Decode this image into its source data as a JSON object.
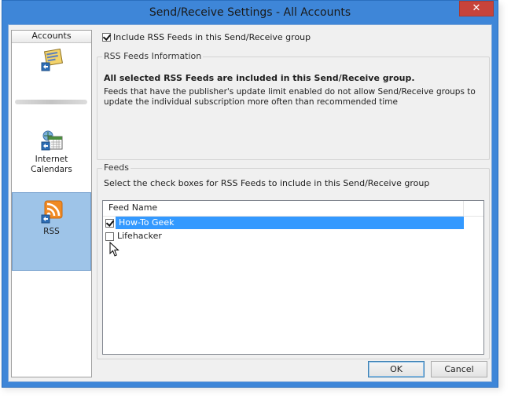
{
  "window": {
    "title": "Send/Receive Settings - All Accounts",
    "close_glyph": "✕"
  },
  "sidebar": {
    "header": "Accounts",
    "items": [
      {
        "label": "",
        "icon": "mail-account-icon"
      },
      {
        "label": "Internet Calendars",
        "line1": "Internet",
        "line2": "Calendars",
        "icon": "calendar-icon"
      },
      {
        "label": "RSS",
        "icon": "rss-icon",
        "selected": true
      }
    ]
  },
  "include_rss": {
    "label": "Include RSS Feeds in this Send/Receive group",
    "checked": true
  },
  "info_group": {
    "title": "RSS Feeds Information",
    "bold_text": "All selected RSS Feeds are included in this Send/Receive group.",
    "description": "Feeds that have the publisher's update limit enabled do not allow Send/Receive groups to update the individual subscription more often than recommended time"
  },
  "feeds_group": {
    "title": "Feeds",
    "instruction": "Select the check boxes for RSS Feeds to include in this Send/Receive group",
    "column_header": "Feed Name",
    "feeds": [
      {
        "name": "How-To Geek",
        "checked": true,
        "selected": true
      },
      {
        "name": "Lifehacker",
        "checked": false,
        "selected": false
      }
    ]
  },
  "buttons": {
    "ok": "OK",
    "cancel": "Cancel"
  },
  "colors": {
    "titlebar": "#3e86d8",
    "close": "#c7433a",
    "selection": "#3399ff",
    "sidebar_selected": "#9ec4e8"
  }
}
